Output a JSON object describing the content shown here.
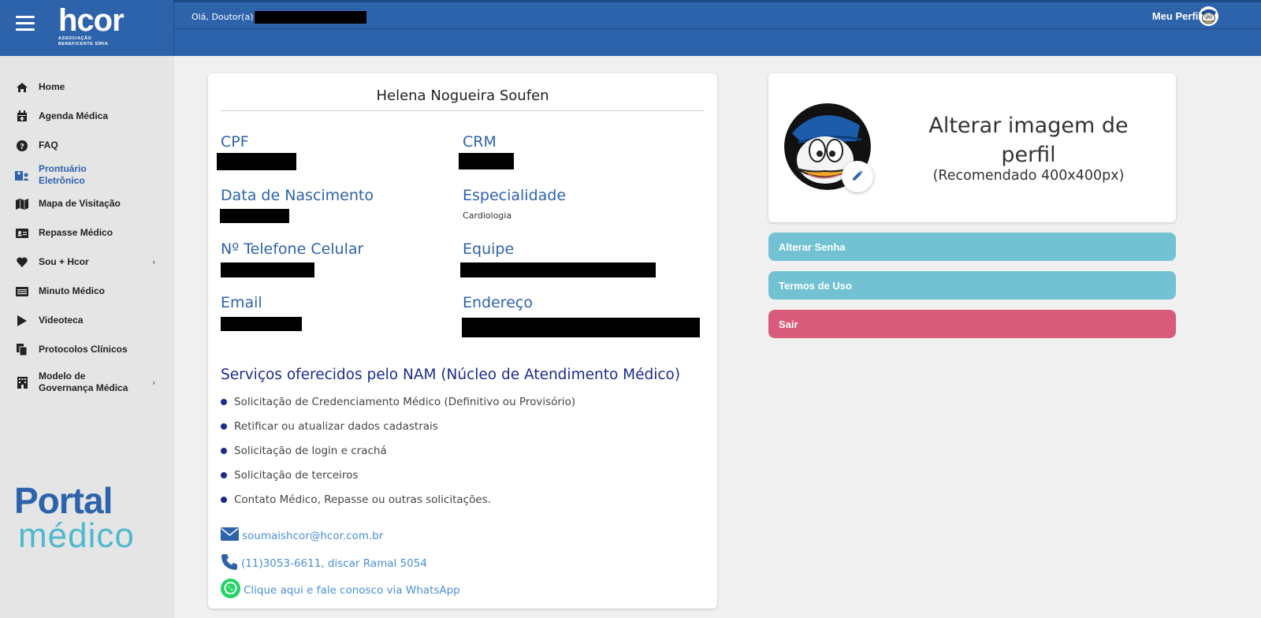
{
  "app": {
    "logo_main": "hcor",
    "logo_sub_line1": "ASSOCIAÇÃO",
    "logo_sub_line2": "BENEFICENTE SÍRIA"
  },
  "sidebar": {
    "items": [
      {
        "label": "Home",
        "icon": "home-icon"
      },
      {
        "label": "Agenda Médica",
        "icon": "calendar-icon"
      },
      {
        "label": "FAQ",
        "icon": "question-icon"
      },
      {
        "label": "Prontuário Eletrônico",
        "icon": "hospital-user-icon",
        "active": true
      },
      {
        "label": "Mapa de Visitação",
        "icon": "map-icon"
      },
      {
        "label": "Repasse Médico",
        "icon": "id-card-icon"
      },
      {
        "label": "Sou + Hcor",
        "icon": "heart-icon",
        "has_submenu": true
      },
      {
        "label": "Minuto Médico",
        "icon": "list-icon"
      },
      {
        "label": "Videoteca",
        "icon": "play-icon"
      },
      {
        "label": "Protocolos Clínicos",
        "icon": "documents-icon"
      },
      {
        "label": "Modelo de Governança Médica",
        "icon": "building-icon",
        "has_submenu": true
      }
    ],
    "portal_top": "Portal",
    "portal_bottom": "médico"
  },
  "topbar": {
    "greeting": "Olá, Doutor(a)",
    "profile_label": "Meu Perfil"
  },
  "profile": {
    "name": "Helena Nogueira Soufen",
    "fields": {
      "cpf_label": "CPF",
      "crm_label": "CRM",
      "birth_label": "Data de Nascimento",
      "specialty_label": "Especialidade",
      "specialty_value": "Cardiologia",
      "phone_label": "Nº Telefone Celular",
      "team_label": "Equipe",
      "email_label": "Email",
      "address_label": "Endereço"
    },
    "services_title": "Serviços oferecidos pelo NAM (Núcleo de Atendimento Médico)",
    "services": [
      "Solicitação de Credenciamento Médico (Definitivo ou Provisório)",
      "Retificar ou atualizar dados cadastrais",
      "Solicitação de login e crachá",
      "Solicitação de terceiros",
      "Contato Médico, Repasse ou outras solicitações."
    ],
    "contact_email": "soumaishcor@hcor.com.br",
    "contact_phone": "(11)3053-6611, discar Ramal 5054",
    "contact_whatsapp": "Clique aqui e fale conosco via WhatsApp"
  },
  "image_card": {
    "title": "Alterar imagem de perfil",
    "subtitle": "(Recomendado 400x400px)"
  },
  "actions": {
    "change_password": "Alterar Senha",
    "terms": "Termos de Uso",
    "logout": "Sair"
  },
  "colors": {
    "primary": "#2d63ab",
    "teal": "#72c2d4",
    "logout": "#d95b7b",
    "services_title": "#1c2b8c",
    "link": "#4a8fd8",
    "whatsapp": "#25d366"
  }
}
